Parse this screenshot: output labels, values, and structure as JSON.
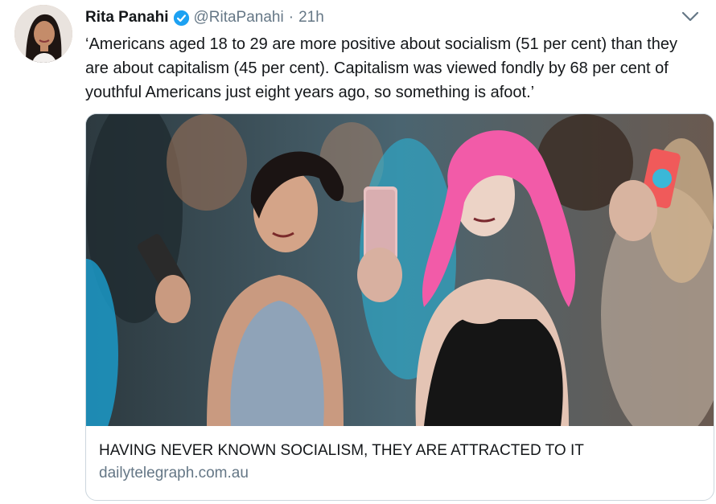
{
  "author": {
    "name": "Rita Panahi",
    "handle": "@RitaPanahi",
    "separator": "·",
    "time": "21h"
  },
  "tweet": {
    "text": "‘Americans aged 18 to 29 are more positive about socialism (51 per cent) than they are about capitalism (45 per cent). Capitalism was viewed fondly by 68 per cent of youthful Americans just eight years ago, so something is afoot.’"
  },
  "card": {
    "title": "HAVING NEVER KNOWN SOCIALISM, THEY ARE ATTRACTED TO IT",
    "domain": "dailytelegraph.com.au"
  },
  "icons": {
    "verified": "verified-badge-icon",
    "menu": "chevron-down-icon"
  },
  "colors": {
    "verified_blue": "#1da1f2",
    "text_primary": "#14171a",
    "text_secondary": "#657786",
    "pink_hair": "#f25ba8"
  }
}
